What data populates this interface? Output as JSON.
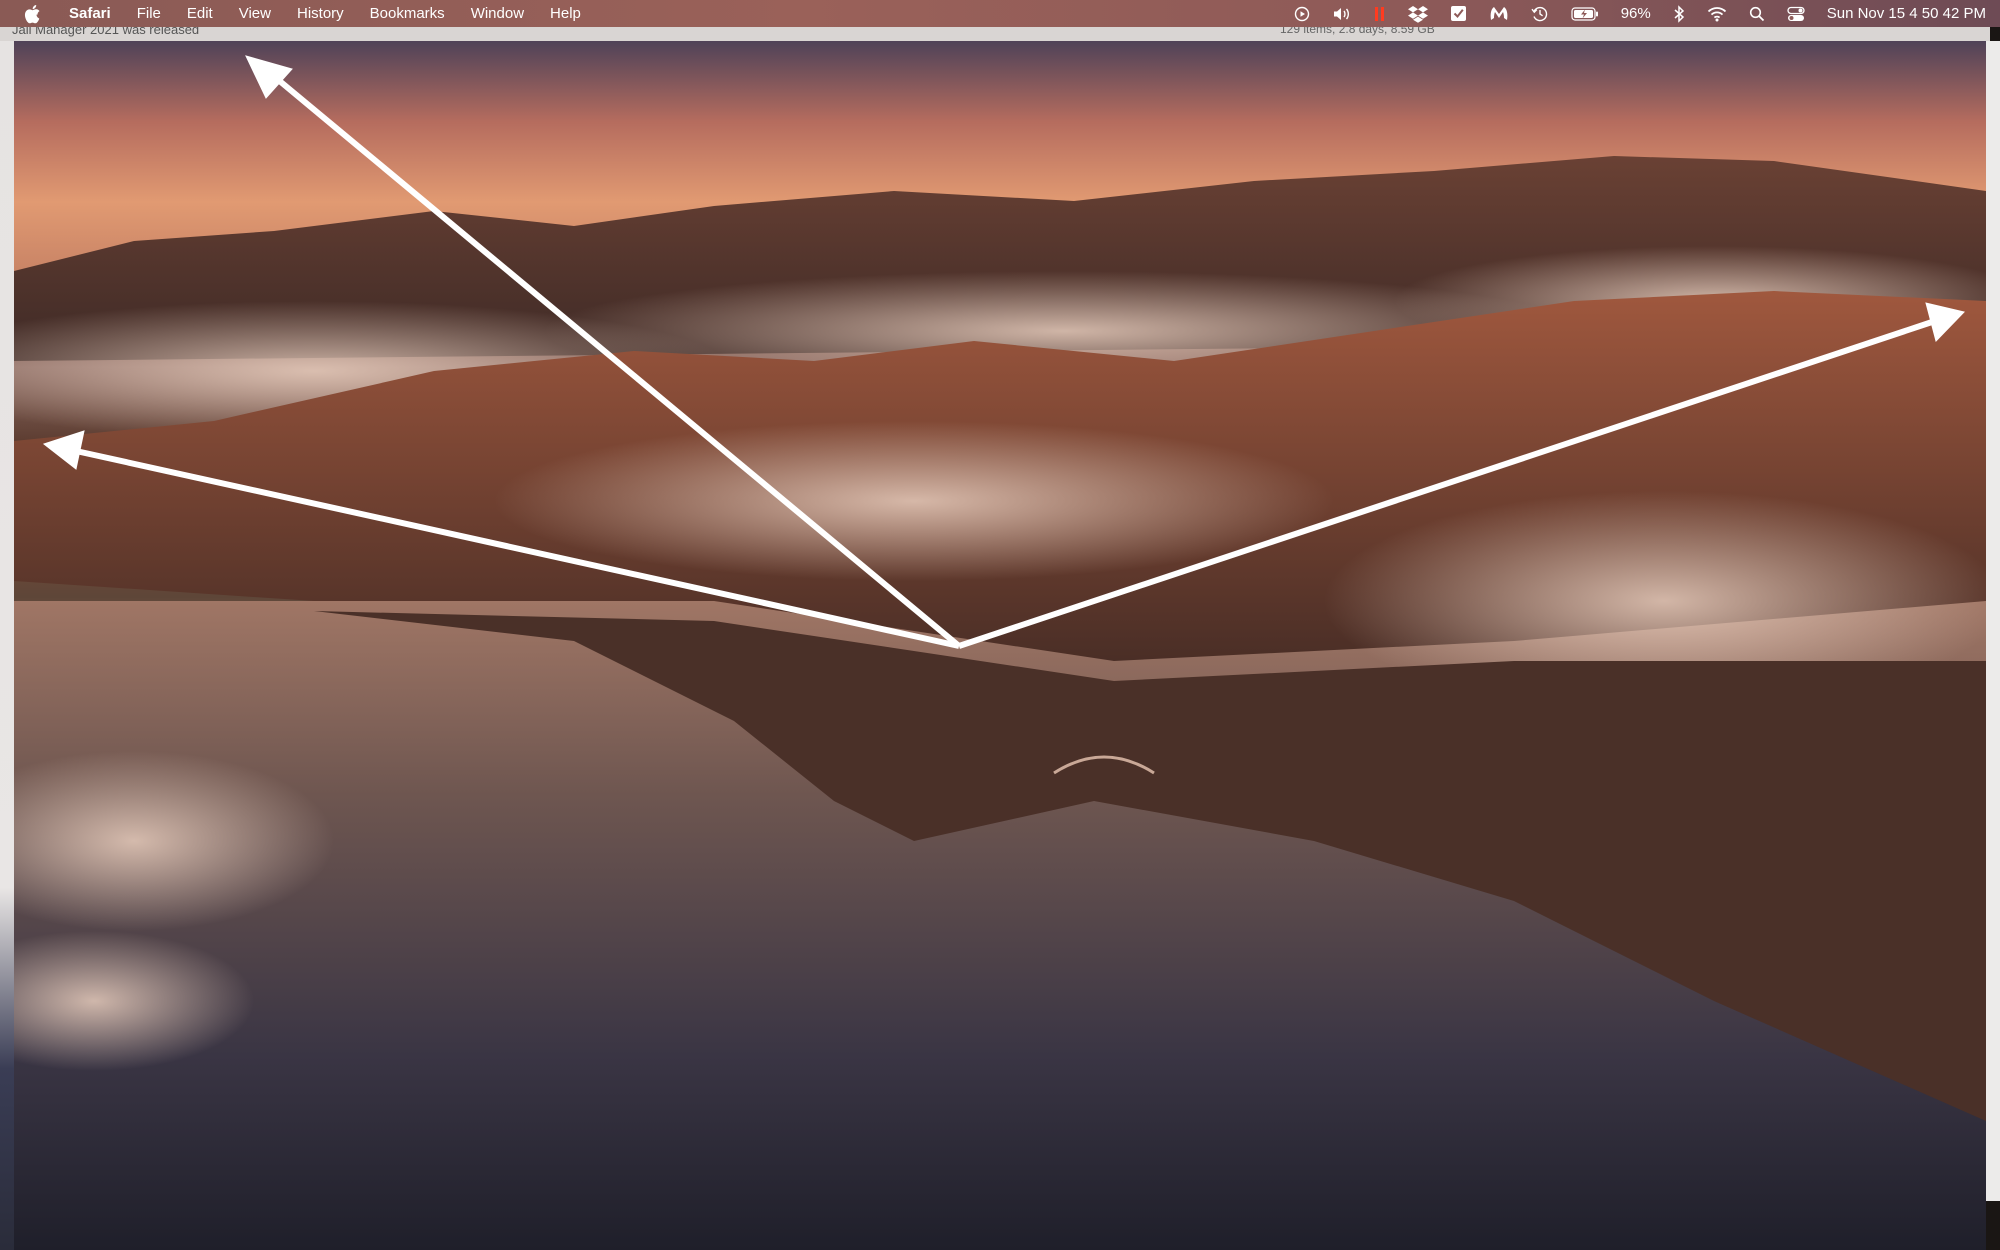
{
  "menubar": {
    "app_name": "Safari",
    "menus": [
      "File",
      "Edit",
      "View",
      "History",
      "Bookmarks",
      "Window",
      "Help"
    ],
    "battery_percent": "96%",
    "datetime": "Sun Nov 15  4 50 42 PM",
    "status_icons": [
      "play-icon",
      "volume-icon",
      "recording-icon",
      "dropbox-icon",
      "checklist-icon",
      "malwarebytes-icon",
      "time-machine-icon",
      "battery-icon",
      "bluetooth-icon",
      "wifi-icon",
      "spotlight-icon",
      "control-center-icon"
    ]
  },
  "background_window": {
    "notice": "Jail Manager 2021 was released",
    "info": "129 items, 2.8 days, 8.59 GB"
  },
  "colors": {
    "menubar": "#935d57",
    "sky": "#d58a6a",
    "sea": "#2e2e3a",
    "arrows": "#ffffff"
  }
}
